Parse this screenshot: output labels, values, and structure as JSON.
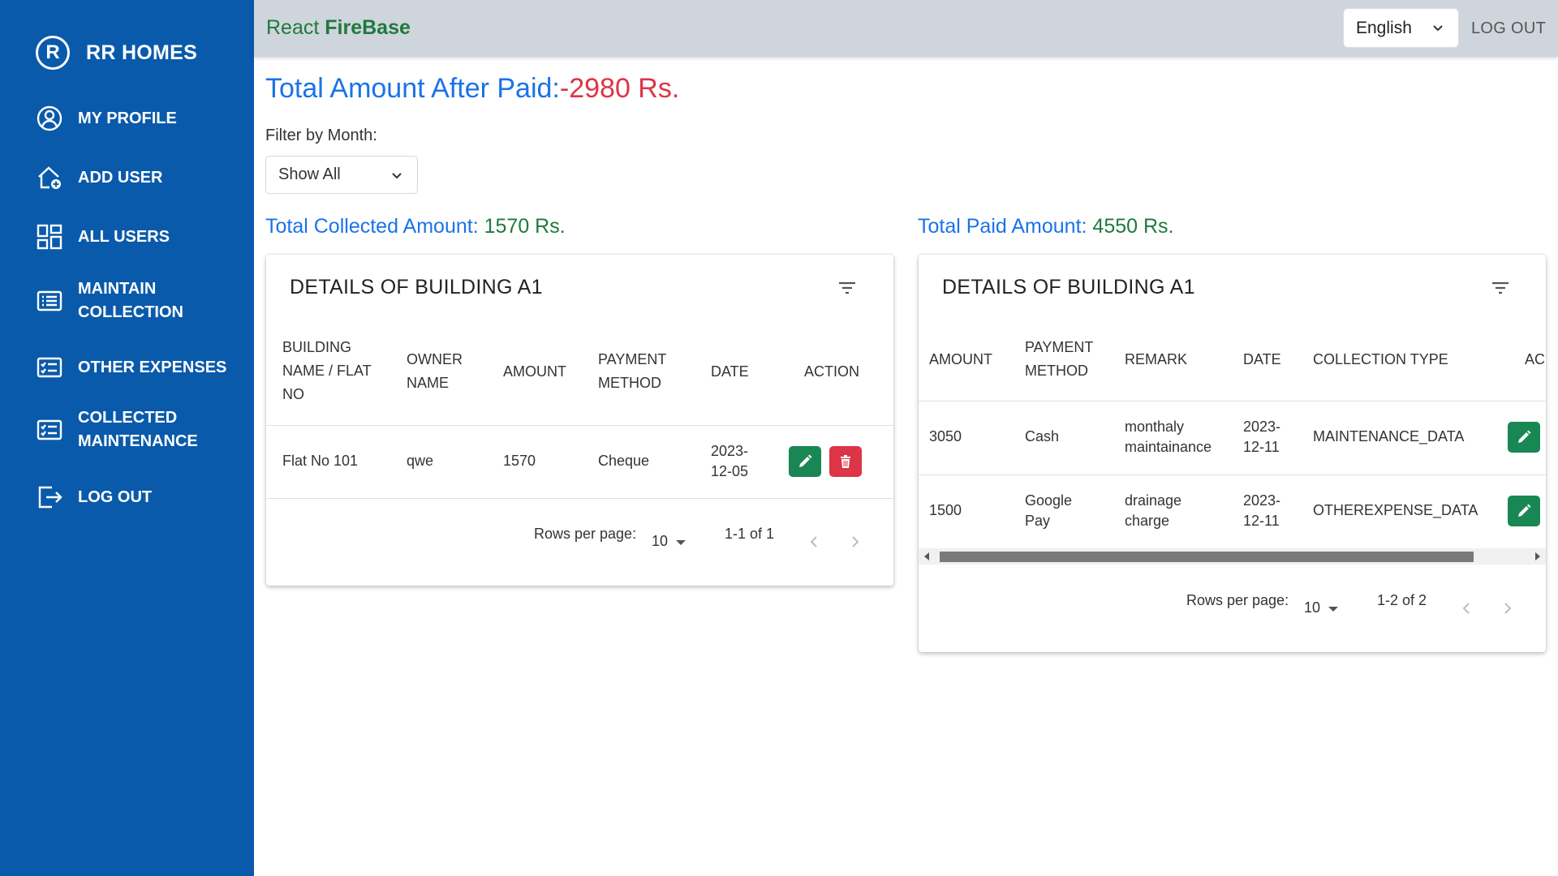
{
  "sidebar": {
    "brand_initial": "R",
    "brand_name": "RR HOMES",
    "items": [
      {
        "label": "MY PROFILE",
        "icon": "user-circle-icon"
      },
      {
        "label": "ADD USER",
        "icon": "home-add-icon"
      },
      {
        "label": "ALL USERS",
        "icon": "dashboard-grid-icon"
      },
      {
        "label": "MAINTAIN COLLECTION",
        "icon": "list-icon"
      },
      {
        "label": "OTHER EXPENSES",
        "icon": "checklist-icon"
      },
      {
        "label": "COLLECTED MAINTENANCE",
        "icon": "checklist-icon"
      },
      {
        "label": "LOG OUT",
        "icon": "logout-icon"
      }
    ]
  },
  "topbar": {
    "title_plain": "React ",
    "title_bold": "FireBase",
    "language": "English",
    "logout": "LOG OUT"
  },
  "summary": {
    "after_paid_label": "Total Amount After Paid:",
    "after_paid_value": "-2980 Rs.",
    "filter_label": "Filter by Month:",
    "filter_value": "Show All",
    "collected_label": "Total Collected Amount:",
    "collected_value": "1570 Rs.",
    "paid_label": "Total Paid Amount:",
    "paid_value": "4550 Rs."
  },
  "collected_table": {
    "title": "DETAILS OF BUILDING A1",
    "headers": {
      "building_1": "BUILDING",
      "building_2": "NAME / FLAT",
      "building_3": "NO",
      "owner_1": "OWNER",
      "owner_2": "NAME",
      "amount": "AMOUNT",
      "method_1": "PAYMENT",
      "method_2": "METHOD",
      "date": "DATE",
      "action": "ACTION"
    },
    "rows": [
      {
        "building": "Flat No 101",
        "owner": "qwe",
        "amount": "1570",
        "method": "Cheque",
        "date_1": "2023-",
        "date_2": "12-05"
      }
    ],
    "rows_per_page_label": "Rows per page:",
    "rows_per_page": "10",
    "range": "1-1 of 1"
  },
  "paid_table": {
    "title": "DETAILS OF BUILDING A1",
    "headers": {
      "amount": "AMOUNT",
      "method_1": "PAYMENT",
      "method_2": "METHOD",
      "remark": "REMARK",
      "date": "DATE",
      "type": "COLLECTION TYPE",
      "action": "AC"
    },
    "rows": [
      {
        "amount": "3050",
        "method_1": "Cash",
        "method_2": "",
        "remark_1": "monthaly",
        "remark_2": "maintainance",
        "date_1": "2023-",
        "date_2": "12-11",
        "type": "MAINTENANCE_DATA"
      },
      {
        "amount": "1500",
        "method_1": "Google",
        "method_2": "Pay",
        "remark_1": "drainage",
        "remark_2": "charge",
        "date_1": "2023-",
        "date_2": "12-11",
        "type": "OTHEREXPENSE_DATA"
      }
    ],
    "rows_per_page_label": "Rows per page:",
    "rows_per_page": "10",
    "range": "1-2 of 2"
  },
  "colors": {
    "sidebar": "#0a5aab",
    "topbar": "#cfd5dc",
    "accent_blue": "#1a73e8",
    "accent_green": "#1e7a3c",
    "danger": "#dc3545",
    "edit": "#198754"
  }
}
